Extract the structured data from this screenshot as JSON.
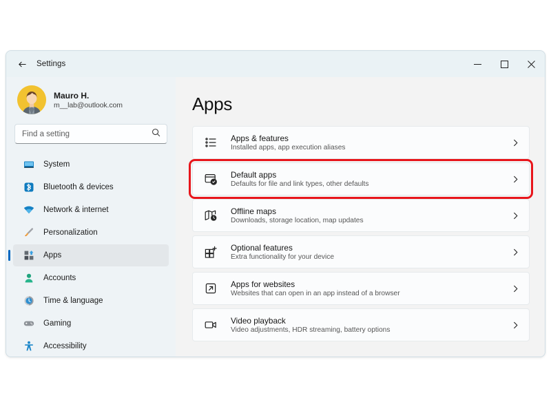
{
  "window": {
    "title": "Settings",
    "back_icon": "back-arrow-icon",
    "controls": {
      "minimize": "minimize-icon",
      "maximize": "maximize-icon",
      "close": "close-icon"
    }
  },
  "sidebar": {
    "account": {
      "name": "Mauro H.",
      "email": "m__lab@outlook.com",
      "avatar_icon": "user-avatar"
    },
    "search": {
      "placeholder": "Find a setting",
      "value": "",
      "icon": "search-icon"
    },
    "items": [
      {
        "label": "System",
        "icon": "monitor-icon",
        "selected": false
      },
      {
        "label": "Bluetooth & devices",
        "icon": "bluetooth-icon",
        "selected": false
      },
      {
        "label": "Network & internet",
        "icon": "wifi-icon",
        "selected": false
      },
      {
        "label": "Personalization",
        "icon": "paintbrush-icon",
        "selected": false
      },
      {
        "label": "Apps",
        "icon": "apps-grid-icon",
        "selected": true
      },
      {
        "label": "Accounts",
        "icon": "person-icon",
        "selected": false
      },
      {
        "label": "Time & language",
        "icon": "clock-icon",
        "selected": false
      },
      {
        "label": "Gaming",
        "icon": "gamepad-icon",
        "selected": false
      },
      {
        "label": "Accessibility",
        "icon": "accessibility-icon",
        "selected": false
      }
    ]
  },
  "main": {
    "title": "Apps",
    "cards": [
      {
        "title": "Apps & features",
        "subtitle": "Installed apps, app execution aliases",
        "icon": "app-list-icon",
        "highlighted": false
      },
      {
        "title": "Default apps",
        "subtitle": "Defaults for file and link types, other defaults",
        "icon": "default-apps-icon",
        "highlighted": true
      },
      {
        "title": "Offline maps",
        "subtitle": "Downloads, storage location, map updates",
        "icon": "map-icon",
        "highlighted": false
      },
      {
        "title": "Optional features",
        "subtitle": "Extra functionality for your device",
        "icon": "optional-features-icon",
        "highlighted": false
      },
      {
        "title": "Apps for websites",
        "subtitle": "Websites that can open in an app instead of a browser",
        "icon": "external-link-icon",
        "highlighted": false
      },
      {
        "title": "Video playback",
        "subtitle": "Video adjustments, HDR streaming, battery options",
        "icon": "video-camera-icon",
        "highlighted": false
      }
    ],
    "chevron_icon": "chevron-right-icon"
  },
  "colors": {
    "accent": "#0067c0",
    "highlight": "#e8151b",
    "sidebar_bg": "#eef3f6",
    "content_bg": "#f3f3f3"
  }
}
